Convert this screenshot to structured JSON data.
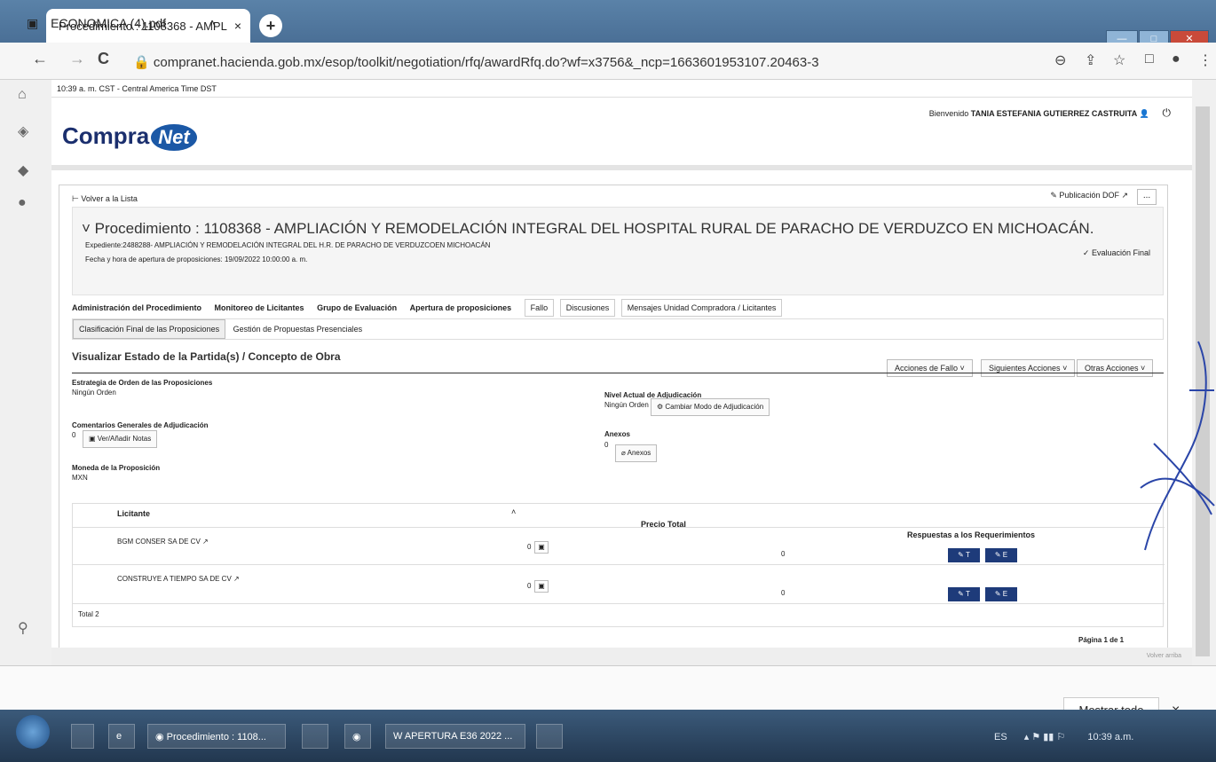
{
  "browser": {
    "tab_title": "Procedimiento : 1108368 - AMPL",
    "tab_close": "×",
    "new_tab": "+",
    "url": "compranet.hacienda.gob.mx/esop/toolkit/negotiation/rfq/awardRfq.do?wf=x3756&_ncp=1663601953107.20463-3",
    "back": "←",
    "forward": "→",
    "reload": "C"
  },
  "page": {
    "timezone": "10:39 a. m. CST - Central America Time DST",
    "welcome_prefix": "Bienvenido",
    "user": "TANIA ESTEFANIA GUTIERREZ CASTRUITA",
    "logo_main": "Compra",
    "logo_net": "Net",
    "back_link": "Volver a la Lista",
    "title": "Procedimiento : 1108368 - AMPLIACIÓN Y REMODELACIÓN INTEGRAL DEL HOSPITAL RURAL DE PARACHO DE VERDUZCO EN MICHOACÁN.",
    "expediente": "Expediente:2488288- AMPLIACIÓN Y REMODELACIÓN INTEGRAL DEL H.R. DE PARACHO DE VERDUZCOEN MICHOACÁN",
    "fecha": "Fecha y hora de apertura de proposiciones: 19/09/2022 10:00:00 a. m.",
    "publicacion": "Publicación DOF",
    "more": "...",
    "evaluacion": "Evaluación Final",
    "tabs": [
      "Administración del Procedimiento",
      "Monitoreo de Licitantes",
      "Grupo de Evaluación",
      "Apertura de proposiciones"
    ],
    "tabs_boxed": [
      "Fallo",
      "Discusiones",
      "Mensajes Unidad Compradora / Licitantes"
    ],
    "subtabs": [
      "Clasificación Final de las Proposiciones",
      "Gestión de Propuestas Presenciales"
    ],
    "section_title": "Visualizar Estado de la Partida(s) / Concepto de Obra",
    "actions": [
      "Acciones de Fallo",
      "Siguientes Acciones",
      "Otras Acciones"
    ],
    "estrategia_label": "Estrategia de Orden de las Proposiciones",
    "estrategia_value": "Ningún Orden",
    "nivel_label": "Nivel Actual de Adjudicación",
    "nivel_value": "Ningún Orden",
    "cambiar_modo": "Cambiar Modo de Adjudicación",
    "comentarios_label": "Comentarios Generales de Adjudicación",
    "comentarios_count": "0",
    "ver_notas": "Ver/Añadir Notas",
    "anexos_label": "Anexos",
    "anexos_count": "0",
    "anexos_btn": "Anexos",
    "moneda_label": "Moneda de la Proposición",
    "moneda_value": "MXN",
    "table": {
      "col_licitante": "Licitante",
      "col_precio": "Precio Total",
      "col_respuestas": "Respuestas a los Requerimientos",
      "rows": [
        {
          "name": "BGM CONSER SA DE CV",
          "count": "0",
          "precio": "0",
          "btn_t": "T",
          "btn_e": "E"
        },
        {
          "name": "CONSTRUYE A TIEMPO SA DE CV",
          "count": "0",
          "precio": "0",
          "btn_t": "T",
          "btn_e": "E"
        }
      ],
      "total": "Total 2",
      "pagina": "Página 1 de 1"
    },
    "volver_arriba": "Volver arriba"
  },
  "downloads": {
    "file": "ECONOMICA (4).pdf",
    "show_all": "Mostrar todo",
    "close": "×"
  },
  "taskbar": {
    "item1": "Procedimiento : 1108...",
    "item2": "APERTURA E36 2022 ...",
    "lang": "ES",
    "time": "10:39 a.m."
  }
}
